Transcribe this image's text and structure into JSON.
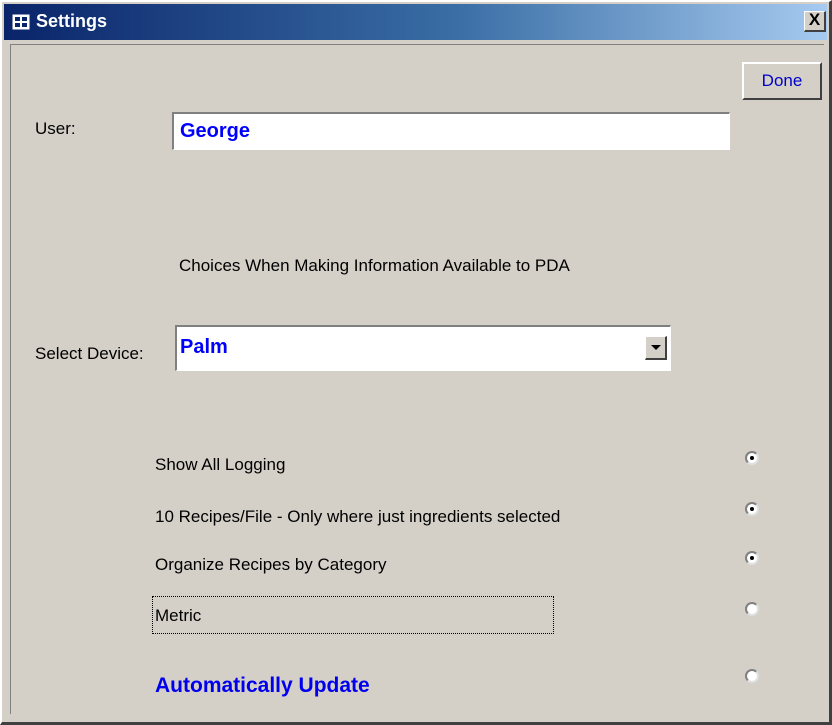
{
  "window": {
    "title": "Settings",
    "close_glyph": "X"
  },
  "done_label": "Done",
  "user": {
    "label": "User:",
    "value": "George"
  },
  "section_heading": "Choices When Making Information Available to PDA",
  "device": {
    "label": "Select Device:",
    "value": "Palm"
  },
  "options": [
    {
      "label": "Show All Logging",
      "selected": true
    },
    {
      "label": "10 Recipes/File - Only where just ingredients selected",
      "selected": true
    },
    {
      "label": "Organize Recipes by Category",
      "selected": true
    },
    {
      "label": "Metric",
      "selected": false
    },
    {
      "label": "Automatically Update",
      "selected": false
    }
  ],
  "colors": {
    "title_gradient_start": "#0a246a",
    "title_gradient_end": "#a6caf0",
    "face": "#d4d0c8",
    "accent_text": "#0000ff"
  },
  "icons": {
    "app": "form-icon",
    "close": "close-icon",
    "dropdown": "chevron-down-icon"
  }
}
